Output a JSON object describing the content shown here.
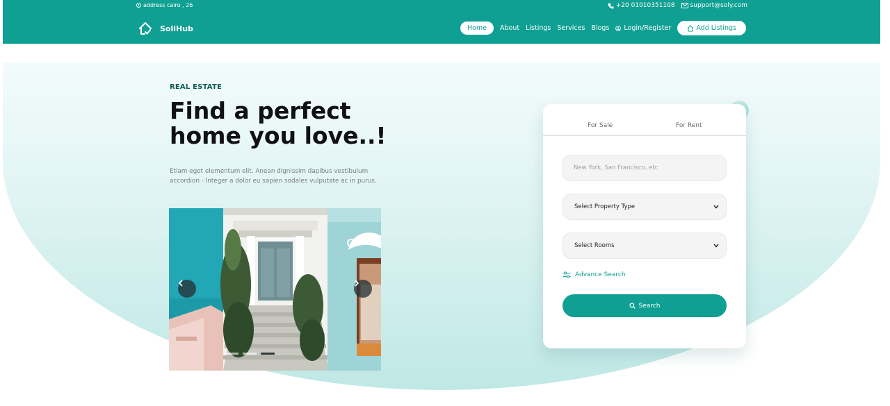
{
  "topbar": {
    "address": "address cairo , 26",
    "phone": "+20 01010351108",
    "email": "support@soly.com"
  },
  "brand": {
    "name": "SoliHub"
  },
  "nav": {
    "home": "Home",
    "about": "About",
    "listings": "Listings",
    "services": "Services",
    "blogs": "Blogs",
    "login": "Login/Register",
    "add_listings": "Add Listings"
  },
  "hero": {
    "eyebrow": "REAL ESTATE",
    "headline_line1": "Find a perfect",
    "headline_line2": "home you love..!",
    "description": "Etiam eget elementum elit. Anean dignissim dapibus vestibulum accordion - Integer a dolor eu sapien sodales vulputate ac in purus."
  },
  "slider": {
    "prev_icon": "chevron-left-icon",
    "next_icon": "chevron-right-icon",
    "active_index": 2,
    "count": 3
  },
  "search_card": {
    "tabs": [
      "For Sale",
      "For Rent"
    ],
    "location_placeholder": "New York, San Francisco, etc",
    "property_type": "Select Property Type",
    "rooms": "Select Rooms",
    "advance_search": "Advance Search",
    "search_button": "Search"
  },
  "colors": {
    "brand": "#10a093",
    "dark_text": "#111111",
    "eyebrow": "#0d5c52"
  }
}
